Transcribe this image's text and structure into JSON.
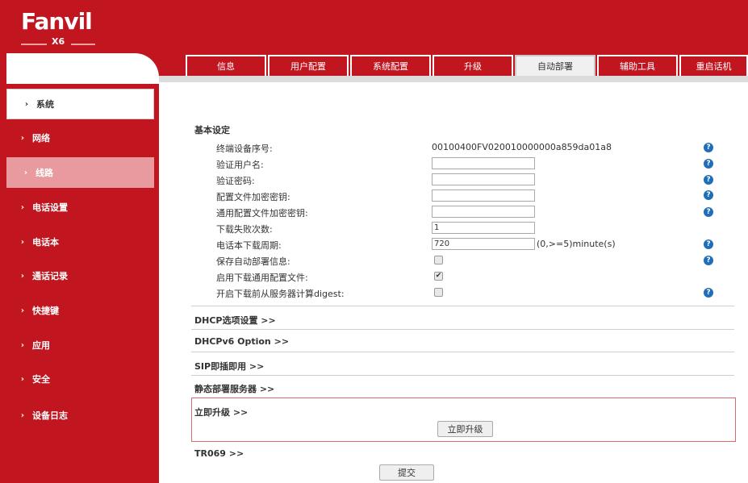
{
  "brand": {
    "logo_text": "Fanvil",
    "model": "X6",
    "color": "#c1161f"
  },
  "tabs": [
    {
      "label": "信息"
    },
    {
      "label": "用户配置"
    },
    {
      "label": "系统配置"
    },
    {
      "label": "升级"
    },
    {
      "label": "自动部署",
      "active": true
    },
    {
      "label": "辅助工具"
    },
    {
      "label": "重启话机"
    }
  ],
  "sidebar": {
    "items": [
      {
        "label": "系统",
        "state": "selected"
      },
      {
        "label": "网络"
      },
      {
        "label": "线路",
        "state": "highlighted"
      },
      {
        "label": "电话设置"
      },
      {
        "label": "电话本"
      },
      {
        "label": "通话记录"
      },
      {
        "label": "快捷键"
      },
      {
        "label": "应用"
      },
      {
        "label": "安全"
      },
      {
        "label": "设备日志"
      }
    ]
  },
  "basic": {
    "title": "基本设定",
    "serial_label": "终端设备序号:",
    "serial_value": "00100400FV020010000000a859da01a8",
    "auth_user_label": "验证用户名:",
    "auth_user_value": "",
    "auth_pass_label": "验证密码:",
    "auth_pass_value": "",
    "cfg_key_label": "配置文件加密密钥:",
    "cfg_key_value": "",
    "common_key_label": "通用配置文件加密密钥:",
    "common_key_value": "",
    "fail_count_label": "下载失败次数:",
    "fail_count_value": "1",
    "pb_period_label": "电话本下载周期:",
    "pb_period_value": "720",
    "pb_period_suffix": "(0,>=5)minute(s)",
    "save_info_label": "保存自动部署信息:",
    "save_info_checked": false,
    "common_cfg_label": "启用下载通用配置文件:",
    "common_cfg_checked": true,
    "digest_label": "开启下载前从服务器计算digest:",
    "digest_checked": false,
    "help_glyph": "?",
    "check_glyph": "✔"
  },
  "sections": {
    "dhcp": "DHCP选项设置 >>",
    "dhcpv6": "DHCPv6 Option >>",
    "sip_pnp": "SIP即插即用 >>",
    "static": "静态部署服务器 >>",
    "upgrade_now": "立即升级 >>",
    "upgrade_now_button": "立即升级",
    "tr069": "TR069 >>",
    "submit_button": "提交"
  }
}
